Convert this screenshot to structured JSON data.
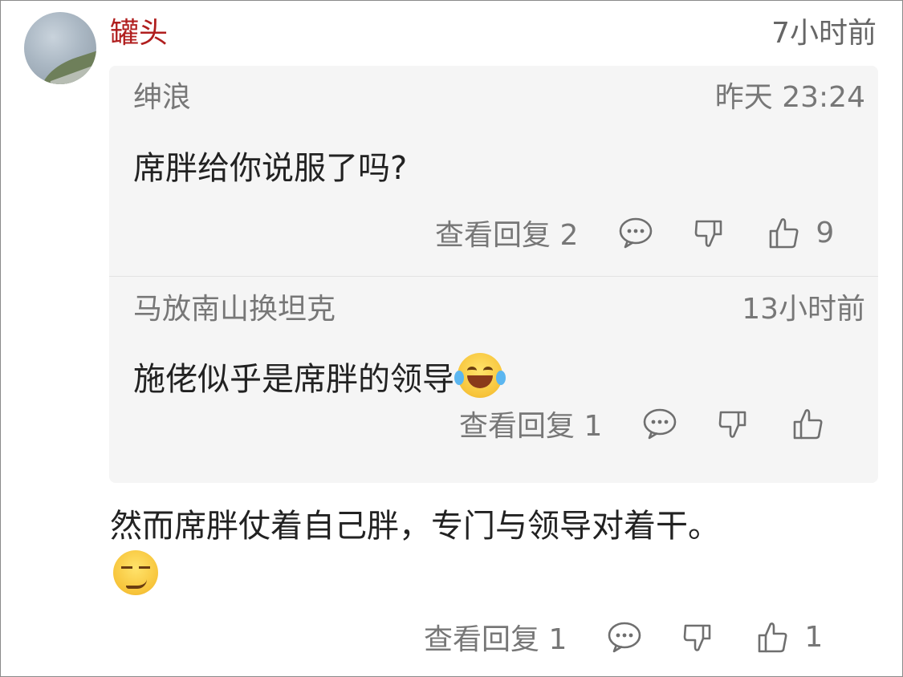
{
  "comment": {
    "username": "罐头",
    "time": "7小时前",
    "text": "然而席胖仗着自己胖，专门与领导对着干。",
    "emoji": "smirking-face",
    "actions": {
      "view_replies": "查看回复 1",
      "like_count": "1"
    }
  },
  "replies": [
    {
      "username": "绅浪",
      "time": "昨天 23:24",
      "text": "席胖给你说服了吗?",
      "actions": {
        "view_replies": "查看回复 2",
        "like_count": "9"
      }
    },
    {
      "username": "马放南山换坦克",
      "time": "13小时前",
      "text": "施佬似乎是席胖的领导",
      "emoji": "face-with-tears-of-joy",
      "actions": {
        "view_replies": "查看回复 1",
        "like_count": ""
      }
    }
  ],
  "colors": {
    "username": "#b01e1e",
    "reply_box_bg": "#f5f5f5",
    "meta_text": "#777777",
    "body_text": "#222222"
  }
}
